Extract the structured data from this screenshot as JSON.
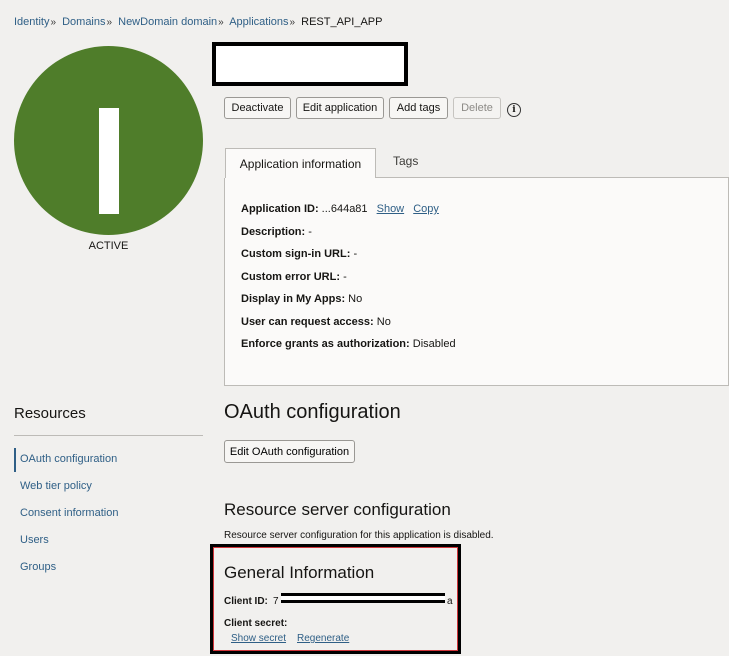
{
  "breadcrumb": {
    "items": [
      "Identity",
      "Domains",
      "NewDomain domain",
      "Applications"
    ],
    "separator": "»",
    "current": "REST_API_APP"
  },
  "avatar": {
    "letter": "I",
    "color": "#4f7d2a",
    "status": "ACTIVE"
  },
  "actions": {
    "deactivate": "Deactivate",
    "edit_application": "Edit application",
    "add_tags": "Add tags",
    "delete": "Delete",
    "info_icon": "i"
  },
  "tabs": {
    "active": "Application information",
    "other": "Tags"
  },
  "app_info": {
    "application_id_label": "Application ID:",
    "application_id_value": "...644a81",
    "show_link": "Show",
    "copy_link": "Copy",
    "description_label": "Description:",
    "description_value": "-",
    "custom_signin_label": "Custom sign-in URL:",
    "custom_signin_value": "-",
    "custom_error_label": "Custom error URL:",
    "custom_error_value": "-",
    "display_apps_label": "Display in My Apps:",
    "display_apps_value": "No",
    "request_access_label": "User can request access:",
    "request_access_value": "No",
    "enforce_grants_label": "Enforce grants as authorization:",
    "enforce_grants_value": "Disabled"
  },
  "resources": {
    "title": "Resources",
    "items": [
      "OAuth configuration",
      "Web tier policy",
      "Consent information",
      "Users",
      "Groups"
    ],
    "active": "OAuth configuration"
  },
  "oauth": {
    "title": "OAuth configuration",
    "edit_button": "Edit OAuth configuration",
    "resource_server_title": "Resource server configuration",
    "resource_server_desc": "Resource server configuration for this application is disabled."
  },
  "general_info": {
    "title": "General Information",
    "client_id_label": "Client ID:",
    "client_id_prefix": "7",
    "client_id_suffix": "a",
    "client_secret_label": "Client secret:",
    "show_secret": "Show secret",
    "regenerate": "Regenerate"
  },
  "colors": {
    "link": "#2f5f86",
    "avatar": "#4f7d2a",
    "highlight_border": "#d0353a"
  }
}
